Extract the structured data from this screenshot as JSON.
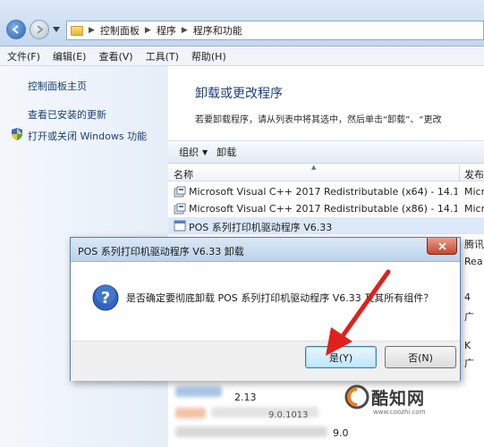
{
  "address_bar": {
    "breadcrumbs": [
      "控制面板",
      "程序",
      "程序和功能"
    ]
  },
  "menu": {
    "items": [
      "文件(F)",
      "编辑(E)",
      "查看(V)",
      "工具(T)",
      "帮助(H)"
    ]
  },
  "sidebar": {
    "home_link": "控制面板主页",
    "updates_link": "查看已安装的更新",
    "features_link": "打开或关闭 Windows 功能"
  },
  "main": {
    "heading": "卸载或更改程序",
    "description": "若要卸载程序，请从列表中将其选中，然后单击“卸载”、“更改",
    "toolbar": {
      "organize_label": "组织",
      "uninstall_label": "卸载"
    },
    "columns": {
      "name": "名称",
      "publisher": "发布"
    },
    "rows": [
      {
        "name": "Microsoft Visual C++ 2017 Redistributable (x64) - 14.1...",
        "publisher": "Micr"
      },
      {
        "name": "Microsoft Visual C++ 2017 Redistributable (x86) - 14.1...",
        "publisher": "Micr"
      },
      {
        "name": "POS 系列打印机驱动程序 V6.33",
        "publisher": ""
      }
    ],
    "side_fragments": [
      "腾讯",
      "Rea",
      "4",
      "广",
      "",
      "K",
      "广"
    ],
    "lower_rows": [
      "2.13",
      "9.0.1013",
      "9.0"
    ]
  },
  "dialog": {
    "title": "POS 系列打印机驱动程序 V6.33 卸载",
    "message": "是否确定要彻底卸载 POS 系列打印机驱动程序 V6.33 及其所有组件？",
    "yes_label": "是(Y)",
    "no_label": "否(N)"
  },
  "watermark": {
    "text": "酷知网",
    "url": "www.coozhi.com"
  },
  "colors": {
    "arrow": "#e0201c",
    "link": "#1c3f78",
    "heading": "#1e3f7a"
  }
}
